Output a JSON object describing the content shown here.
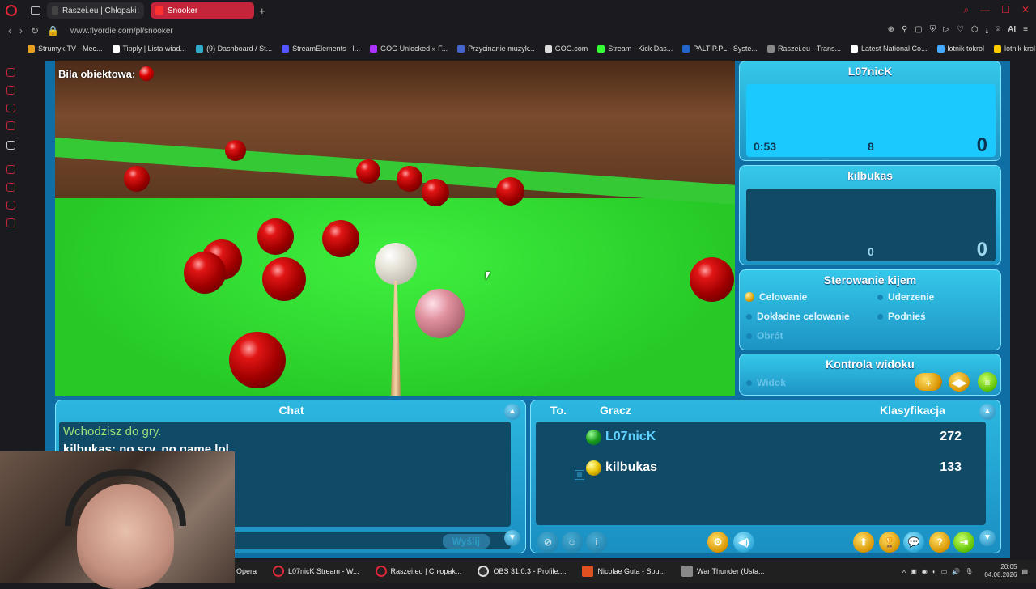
{
  "browser": {
    "tabs": [
      {
        "label": "Raszei.eu | Chłopaki z Ras",
        "active": false
      },
      {
        "label": "Snooker",
        "active": true
      }
    ],
    "url": "www.flyordie.com/pl/snooker",
    "bookmarks": [
      "Strumyk.TV - Mec...",
      "Tipply | Lista wiad...",
      "(9) Dashboard / St...",
      "StreamElements - l...",
      "GOG Unlocked » F...",
      "Przycinanie muzyk...",
      "GOG.com",
      "Stream - Kick Das...",
      "PALTIP.PL - Syste...",
      "Raszei.eu - Trans...",
      "Latest National Co...",
      "lotnik tokrol",
      "lotnik krol"
    ],
    "ai_label": "AI"
  },
  "game": {
    "object_ball_label": "Bila obiektowa:",
    "player1": {
      "name": "L07nicK",
      "time": "0:53",
      "break": "8",
      "score": "0"
    },
    "player2": {
      "name": "kilbukas",
      "break": "0",
      "score": "0"
    },
    "cue_control": {
      "title": "Sterowanie kijem",
      "options": [
        {
          "label": "Celowanie",
          "selected": true
        },
        {
          "label": "Uderzenie",
          "selected": false
        },
        {
          "label": "Dokładne celowanie",
          "selected": false
        },
        {
          "label": "Podnieś",
          "selected": false
        },
        {
          "label": "Obrót",
          "selected": false
        }
      ]
    },
    "view_control": {
      "title": "Kontrola widoku",
      "option": "Widok"
    },
    "chat": {
      "title": "Chat",
      "messages": [
        "Wchodzisz do gry.",
        "kilbukas: no sry, no game lol"
      ],
      "send_label": "Wyślij"
    },
    "players_table": {
      "col_to": "To.",
      "col_player": "Gracz",
      "col_rank": "Klasyfikacja",
      "rows": [
        {
          "name": "L07nicK",
          "rating": "272",
          "ball_color": "#1a9a1a"
        },
        {
          "name": "kilbukas",
          "rating": "133",
          "ball_color": "#e8c000"
        }
      ]
    }
  },
  "taskbar": {
    "items": [
      "Opera",
      "L07nicK Stream - W...",
      "Raszei.eu | Chłopak...",
      "OBS 31.0.3 - Profile:...",
      "Nicolae Guta - Spu...",
      "War Thunder (Usta..."
    ],
    "time": "20:05",
    "date": "04.08.2026"
  }
}
